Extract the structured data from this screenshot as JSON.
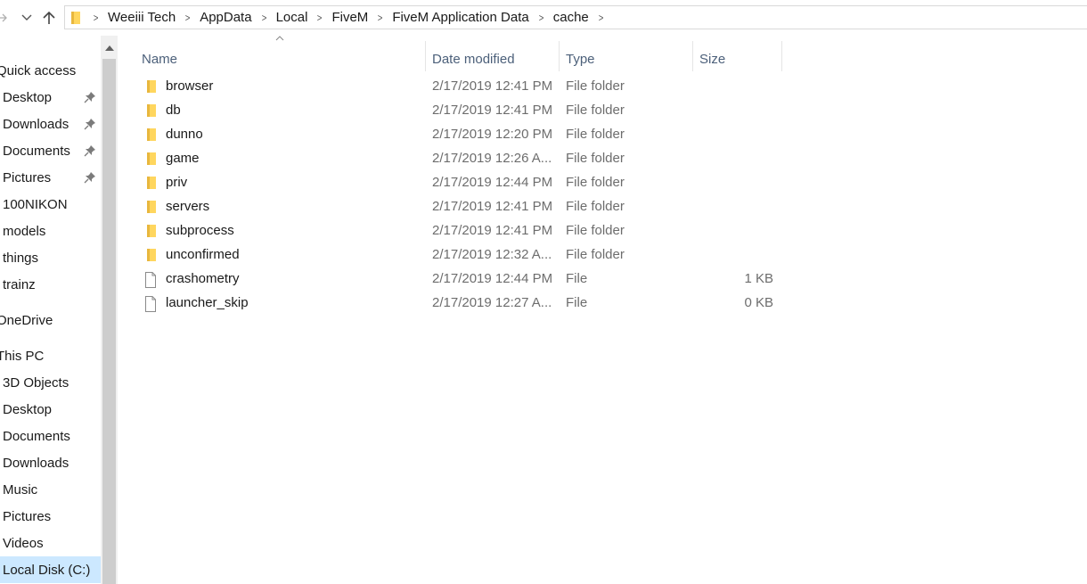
{
  "breadcrumb": [
    "Weeiii Tech",
    "AppData",
    "Local",
    "FiveM",
    "FiveM Application Data",
    "cache"
  ],
  "sidebar": {
    "items": [
      {
        "label": "Quick access",
        "pinned": false
      },
      {
        "label": "Desktop",
        "pinned": true
      },
      {
        "label": "Downloads",
        "pinned": true
      },
      {
        "label": "Documents",
        "pinned": true
      },
      {
        "label": "Pictures",
        "pinned": true
      },
      {
        "label": "100NIKON",
        "pinned": false
      },
      {
        "label": "models",
        "pinned": false
      },
      {
        "label": "things",
        "pinned": false
      },
      {
        "label": "trainz",
        "pinned": false
      },
      {
        "label": "OneDrive",
        "pinned": false
      },
      {
        "label": "This PC",
        "pinned": false
      },
      {
        "label": "3D Objects",
        "pinned": false
      },
      {
        "label": "Desktop",
        "pinned": false
      },
      {
        "label": "Documents",
        "pinned": false
      },
      {
        "label": "Downloads",
        "pinned": false
      },
      {
        "label": "Music",
        "pinned": false
      },
      {
        "label": "Pictures",
        "pinned": false
      },
      {
        "label": "Videos",
        "pinned": false
      },
      {
        "label": "Local Disk (C:)",
        "pinned": false,
        "selected": true
      }
    ]
  },
  "columns": {
    "name": "Name",
    "date": "Date modified",
    "type": "Type",
    "size": "Size"
  },
  "files": [
    {
      "name": "browser",
      "date": "2/17/2019 12:41 PM",
      "type": "File folder",
      "size": "",
      "icon": "folder-icon"
    },
    {
      "name": "db",
      "date": "2/17/2019 12:41 PM",
      "type": "File folder",
      "size": "",
      "icon": "folder-icon"
    },
    {
      "name": "dunno",
      "date": "2/17/2019 12:20 PM",
      "type": "File folder",
      "size": "",
      "icon": "folder-icon"
    },
    {
      "name": "game",
      "date": "2/17/2019 12:26 A...",
      "type": "File folder",
      "size": "",
      "icon": "folder-icon"
    },
    {
      "name": "priv",
      "date": "2/17/2019 12:44 PM",
      "type": "File folder",
      "size": "",
      "icon": "folder-icon"
    },
    {
      "name": "servers",
      "date": "2/17/2019 12:41 PM",
      "type": "File folder",
      "size": "",
      "icon": "folder-icon"
    },
    {
      "name": "subprocess",
      "date": "2/17/2019 12:41 PM",
      "type": "File folder",
      "size": "",
      "icon": "folder-icon"
    },
    {
      "name": "unconfirmed",
      "date": "2/17/2019 12:32 A...",
      "type": "File folder",
      "size": "",
      "icon": "folder-icon"
    },
    {
      "name": "crashometry",
      "date": "2/17/2019 12:44 PM",
      "type": "File",
      "size": "1 KB",
      "icon": "file-icon"
    },
    {
      "name": "launcher_skip",
      "date": "2/17/2019 12:27 A...",
      "type": "File",
      "size": "0 KB",
      "icon": "file-icon"
    }
  ],
  "colors": {
    "header_text": "#4c607a",
    "secondary_text": "#6d6d6d",
    "folder_yellow": "#ffd65e",
    "selection": "#cce8ff"
  }
}
